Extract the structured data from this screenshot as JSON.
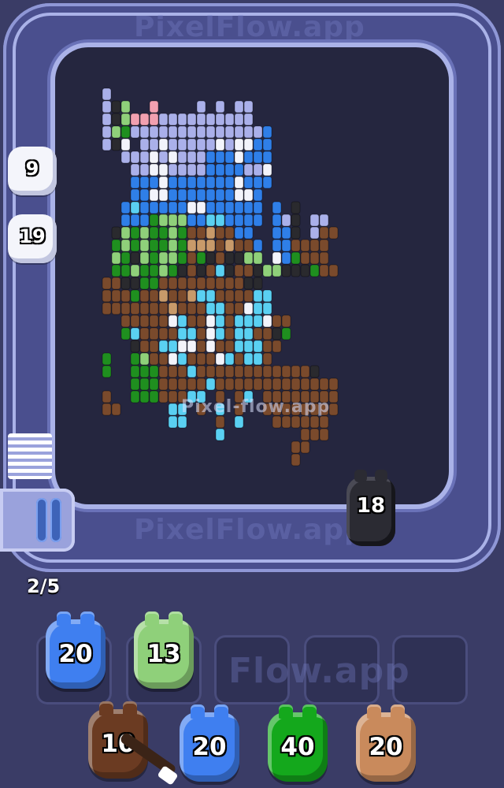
{
  "watermarks": {
    "top": "PixelFlow.app",
    "right": "PixelFlow.app",
    "left": "Pixel",
    "bottom": "PixelFlow.app",
    "center": "Pixel-flow.app",
    "slots": "Flow.app"
  },
  "conveyor_pigs": [
    {
      "count": "9"
    },
    {
      "count": "19"
    }
  ],
  "shooter_pig": {
    "count": "18",
    "color": "#2b2b33"
  },
  "progress": {
    "label": "2/5",
    "current": 2,
    "total": 5
  },
  "waiting_slots": [
    {
      "count": "20",
      "color": "#3f7ff0",
      "filled": true
    },
    {
      "count": "13",
      "color": "#8fd07a",
      "filled": true
    },
    {
      "count": "",
      "filled": false
    },
    {
      "count": "",
      "filled": false
    },
    {
      "count": "",
      "filled": false
    }
  ],
  "queue_pigs": [
    {
      "count": "10",
      "color": "#6b3b22"
    },
    {
      "count": "20",
      "color": "#3f7ff0"
    },
    {
      "count": "40",
      "color": "#14a81c"
    },
    {
      "count": "20",
      "color": "#c98a5c"
    }
  ],
  "palette": {
    "W": "#f3f4fb",
    "L": "#aab0ea",
    "B": "#2f7fe8",
    "C": "#5ad0f2",
    "G": "#1f8f1f",
    "g": "#8fd07a",
    "N": "#7a4a2c",
    "D": "#2a2a2e",
    "P": "#f2a0b0",
    "T": "#c89a6a"
  }
}
